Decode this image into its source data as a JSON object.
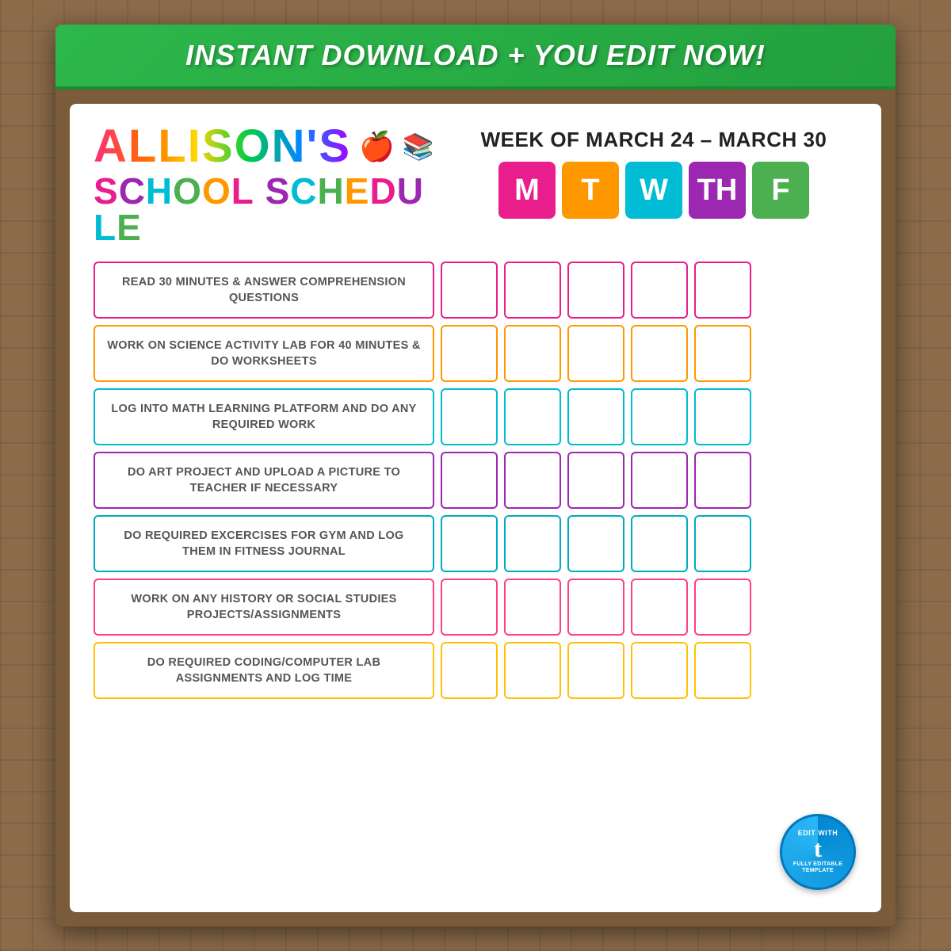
{
  "banner": {
    "text": "INSTANT DOWNLOAD + YOU EDIT NOW!"
  },
  "header": {
    "name": "ALLISON'S",
    "title_line1": "SCHOOL SCHEDULE",
    "week_label": "WEEK OF MARCH 24 – MARCH 30",
    "days": [
      {
        "label": "M",
        "color_class": "day-m"
      },
      {
        "label": "T",
        "color_class": "day-t"
      },
      {
        "label": "W",
        "color_class": "day-w"
      },
      {
        "label": "TH",
        "color_class": "day-th"
      },
      {
        "label": "F",
        "color_class": "day-f"
      }
    ]
  },
  "tasks": [
    {
      "id": 1,
      "text": "READ 30 MINUTES & ANSWER COMPREHENSION QUESTIONS",
      "color_class": "row-pink"
    },
    {
      "id": 2,
      "text": "WORK ON SCIENCE ACTIVITY LAB FOR 40 MINUTES & DO WORKSHEETS",
      "color_class": "row-orange"
    },
    {
      "id": 3,
      "text": "LOG INTO MATH LEARNING PLATFORM AND DO ANY REQUIRED WORK",
      "color_class": "row-teal"
    },
    {
      "id": 4,
      "text": "DO ART PROJECT AND UPLOAD A PICTURE TO TEACHER IF NECESSARY",
      "color_class": "row-purple"
    },
    {
      "id": 5,
      "text": "DO REQUIRED EXCERCISES FOR GYM AND LOG THEM IN FITNESS JOURNAL",
      "color_class": "row-cyan"
    },
    {
      "id": 6,
      "text": "WORK ON ANY HISTORY OR SOCIAL STUDIES PROJECTS/ASSIGNMENTS",
      "color_class": "row-hotpink"
    },
    {
      "id": 7,
      "text": "DO REQUIRED CODING/COMPUTER LAB ASSIGNMENTS AND LOG TIME",
      "color_class": "row-gold"
    }
  ],
  "templett": {
    "label": "EDIT WITH",
    "name": "templett",
    "t": "t",
    "sublabel": "FULLY EDITABLE TEMPLATE"
  }
}
